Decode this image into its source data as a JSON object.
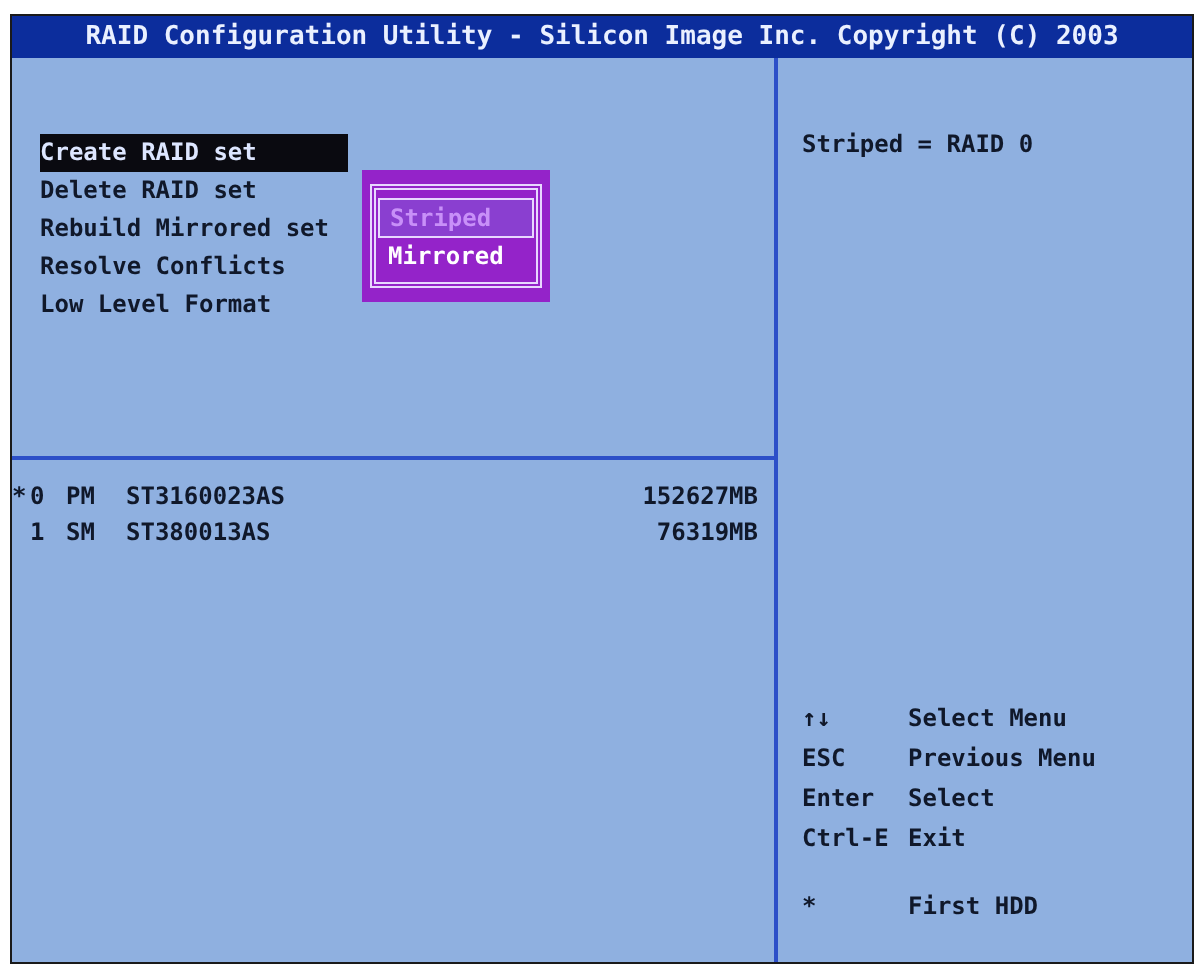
{
  "window": {
    "title": "RAID Configuration Utility - Silicon Image Inc. Copyright (C) 2003"
  },
  "menu": {
    "items": [
      {
        "label": "Create RAID set",
        "selected": true
      },
      {
        "label": "Delete RAID set",
        "selected": false
      },
      {
        "label": "Rebuild Mirrored set",
        "selected": false
      },
      {
        "label": "Resolve Conflicts",
        "selected": false
      },
      {
        "label": "Low Level Format",
        "selected": false
      }
    ]
  },
  "popup": {
    "items": [
      {
        "label": "Striped",
        "selected": true
      },
      {
        "label": "Mirrored",
        "selected": false
      }
    ]
  },
  "drives": [
    {
      "marker": "*",
      "index": "0",
      "role": "PM",
      "model": "ST3160023AS",
      "size": "152627MB"
    },
    {
      "index": "1",
      "role": "SM",
      "model": "ST380013AS",
      "size": "76319MB"
    }
  ],
  "help": {
    "description": "Striped = RAID 0",
    "keys": [
      {
        "key": "↑↓",
        "action": "Select Menu"
      },
      {
        "key": "ESC",
        "action": "Previous Menu"
      },
      {
        "key": "Enter",
        "action": "Select"
      },
      {
        "key": "Ctrl-E",
        "action": "Exit"
      }
    ],
    "legend": [
      {
        "key": "*",
        "action": "First HDD"
      }
    ]
  }
}
